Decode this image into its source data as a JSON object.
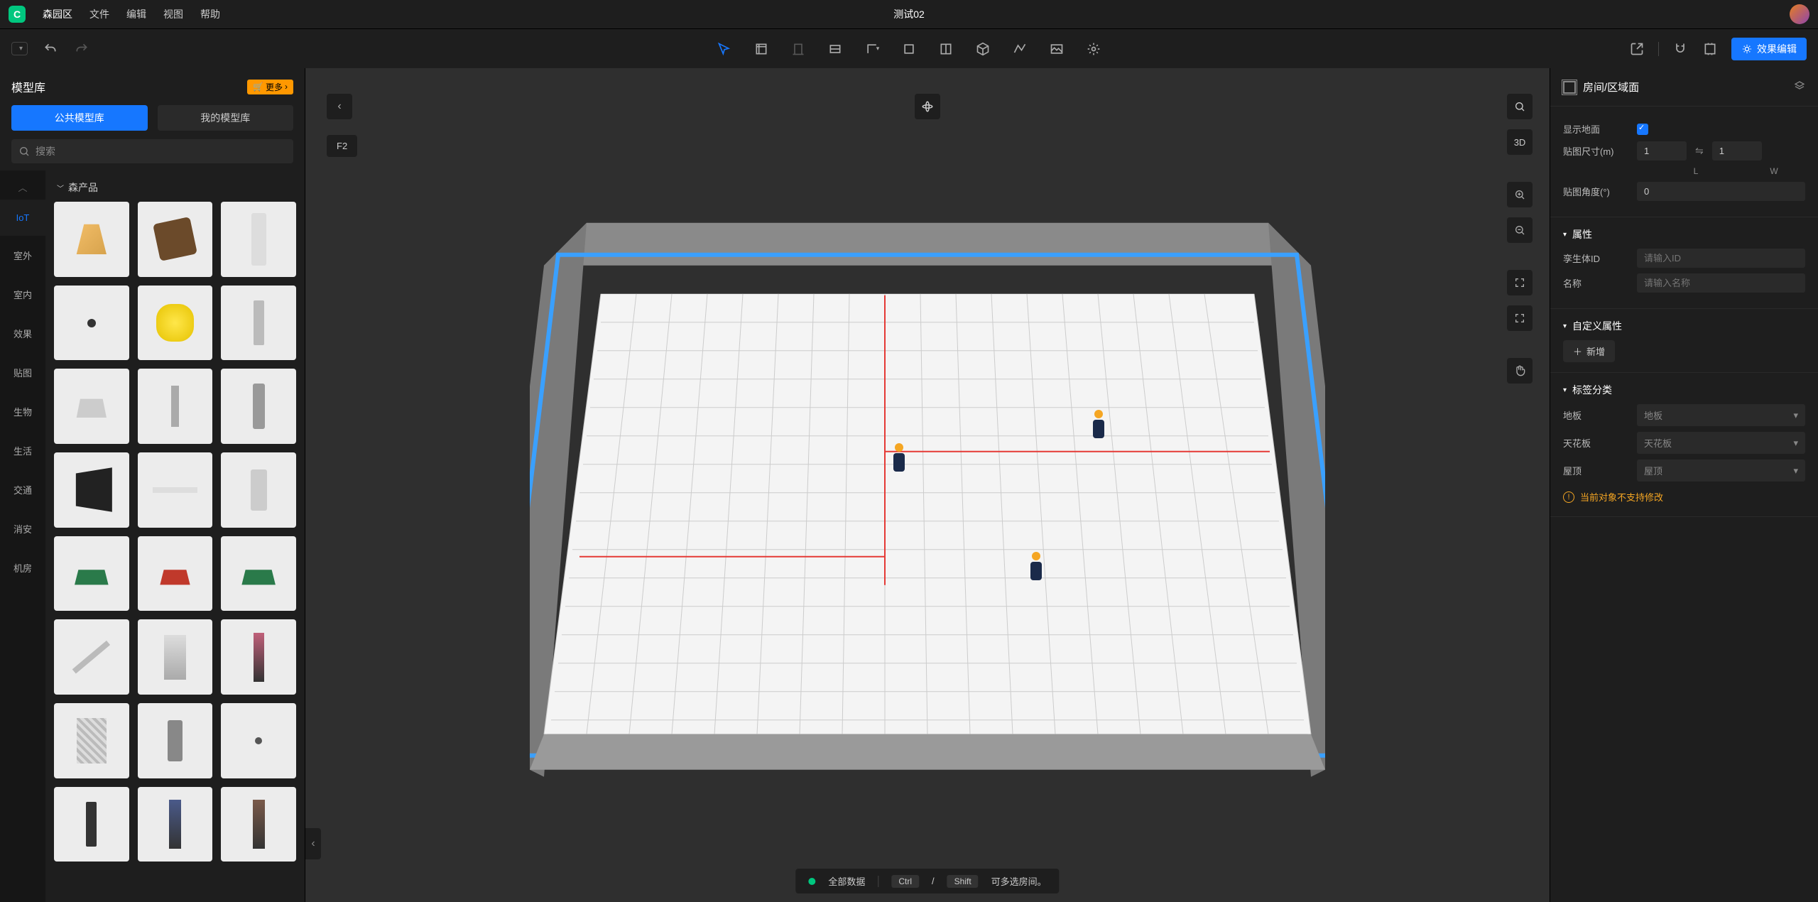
{
  "app_name": "森园区",
  "menu": {
    "file": "文件",
    "edit": "编辑",
    "view": "视图",
    "help": "帮助"
  },
  "doc_title": "测试02",
  "toolbar": {
    "effect_edit": "效果编辑"
  },
  "left": {
    "title": "模型库",
    "more": "更多",
    "tab_public": "公共模型库",
    "tab_mine": "我的模型库",
    "search_placeholder": "搜索",
    "section": "森产品",
    "categories": [
      "IoT",
      "室外",
      "室内",
      "效果",
      "贴图",
      "生物",
      "生活",
      "交通",
      "消安",
      "机房"
    ],
    "active_category": "IoT"
  },
  "canvas": {
    "floor": "F2",
    "view_mode": "3D",
    "status_all_data": "全部数据",
    "status_hint": "可多选房间。",
    "kbd_ctrl": "Ctrl",
    "kbd_sep": "/",
    "kbd_shift": "Shift"
  },
  "right": {
    "title": "房间/区域面",
    "show_ground": "显示地面",
    "texture_size": "贴图尺寸(m)",
    "texture_size_l": "1",
    "texture_size_w": "1",
    "dim_l": "L",
    "dim_w": "W",
    "texture_angle": "贴图角度(°)",
    "texture_angle_val": "0",
    "section_props": "属性",
    "twin_id_label": "孪生体ID",
    "twin_id_placeholder": "请输入ID",
    "name_label": "名称",
    "name_placeholder": "请输入名称",
    "section_custom": "自定义属性",
    "add_new": "新增",
    "section_tags": "标签分类",
    "tag_floor_label": "地板",
    "tag_floor_value": "地板",
    "tag_ceiling_label": "天花板",
    "tag_ceiling_value": "天花板",
    "tag_roof_label": "屋顶",
    "tag_roof_value": "屋顶",
    "warn": "当前对象不支持修改"
  }
}
